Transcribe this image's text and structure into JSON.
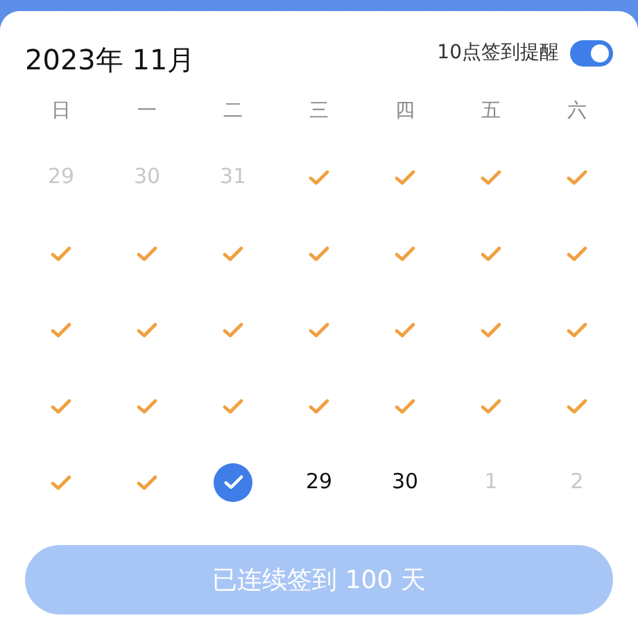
{
  "header": {
    "title": "2023年 11月",
    "reminder_label": "10点签到提醒",
    "reminder_on": true
  },
  "weekdays": [
    "日",
    "一",
    "二",
    "三",
    "四",
    "五",
    "六"
  ],
  "days": [
    {
      "kind": "day",
      "text": "29",
      "muted": true
    },
    {
      "kind": "day",
      "text": "30",
      "muted": true
    },
    {
      "kind": "day",
      "text": "31",
      "muted": true
    },
    {
      "kind": "checked"
    },
    {
      "kind": "checked"
    },
    {
      "kind": "checked"
    },
    {
      "kind": "checked"
    },
    {
      "kind": "checked"
    },
    {
      "kind": "checked"
    },
    {
      "kind": "checked"
    },
    {
      "kind": "checked"
    },
    {
      "kind": "checked"
    },
    {
      "kind": "checked"
    },
    {
      "kind": "checked"
    },
    {
      "kind": "checked"
    },
    {
      "kind": "checked"
    },
    {
      "kind": "checked"
    },
    {
      "kind": "checked"
    },
    {
      "kind": "checked"
    },
    {
      "kind": "checked"
    },
    {
      "kind": "checked"
    },
    {
      "kind": "checked"
    },
    {
      "kind": "checked"
    },
    {
      "kind": "checked"
    },
    {
      "kind": "checked"
    },
    {
      "kind": "checked"
    },
    {
      "kind": "checked"
    },
    {
      "kind": "checked"
    },
    {
      "kind": "checked"
    },
    {
      "kind": "checked"
    },
    {
      "kind": "today"
    },
    {
      "kind": "day",
      "text": "29",
      "muted": false
    },
    {
      "kind": "day",
      "text": "30",
      "muted": false
    },
    {
      "kind": "day",
      "text": "1",
      "muted": true
    },
    {
      "kind": "day",
      "text": "2",
      "muted": true
    }
  ],
  "streak_button": {
    "label": "已连续签到 100 天"
  }
}
